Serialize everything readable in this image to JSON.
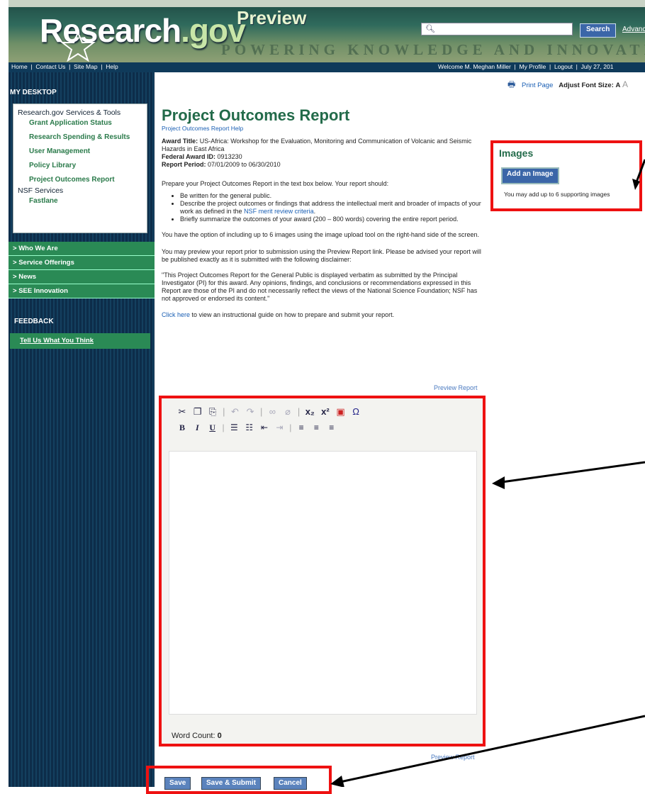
{
  "header": {
    "logo_main": "Research",
    "logo_gov": ".gov",
    "logo_badge": "Preview",
    "tagline": "POWERING KNOWLEDGE AND INNOVATION",
    "search_placeholder": "",
    "search_button": "Search",
    "advanced_link": "Advanced"
  },
  "topnav": {
    "links": [
      "Home",
      "Contact Us",
      "Site Map",
      "Help"
    ],
    "right_items": [
      "Welcome M. Meghan Miller",
      "My Profile",
      "Logout",
      "July 27, 201"
    ]
  },
  "utility": {
    "print_label": "Print Page",
    "font_size_label": "Adjust Font Size:",
    "font_a1": "A",
    "font_a2": "A"
  },
  "sidebar": {
    "desktop_heading": "MY DESKTOP",
    "group1": "Research.gov Services & Tools",
    "group1_items": [
      "Grant Application Status",
      "Research Spending & Results",
      "User Management",
      "Policy Library",
      "Project Outcomes Report"
    ],
    "group2": "NSF Services",
    "group2_items": [
      "Fastlane"
    ],
    "menu": [
      "Who We Are",
      "Service Offerings",
      "News",
      "SEE Innovation"
    ],
    "feedback_heading": "FEEDBACK",
    "feedback_link": "Tell Us What You Think"
  },
  "main": {
    "title": "Project Outcomes Report",
    "help_link": "Project Outcomes Report Help",
    "award_title_label": "Award Title:",
    "award_title": "US-Africa: Workshop for the Evaluation, Monitoring and Communication of Volcanic and Seismic Hazards in East Africa",
    "award_id_label": "Federal Award ID:",
    "award_id": "0913230",
    "period_label": "Report Period:",
    "period": "07/01/2009 to 06/30/2010",
    "intro": "Prepare your Project Outcomes Report in the text box below.  Your report should:",
    "bullet1": "Be written for the general public.",
    "bullet2_pre": "Describe the project outcomes or findings that address the intellectual merit and broader of impacts of your work as defined in the ",
    "bullet2_link": "NSF merit review criteria",
    "bullet2_post": ".",
    "bullet3": "Briefly summarize the outcomes of your award (200 – 800 words) covering the entire report period.",
    "images_option": "You have the option of including up to 6 images using the image upload tool on the right-hand side of the screen.",
    "preview_note": "You may preview your report prior to submission using the Preview Report link.  Please be advised your report will be published exactly as it is submitted with the following disclaimer:",
    "disclaimer": "\"This Project Outcomes Report for the General Public is displayed verbatim as submitted by the Principal Investigator (PI) for this award. Any opinions, findings, and conclusions or recommendations expressed in this Report are those of the PI and do not necessarily reflect the views of the National Science Foundation; NSF has not approved or endorsed its content.\"",
    "click_here": "Click here",
    "guide_text": " to view an instructional guide on how to prepare and submit your report.",
    "preview_report": "Preview Report"
  },
  "editor": {
    "word_count_label": "Word Count:",
    "word_count": "0"
  },
  "images": {
    "title": "Images",
    "add_button": "Add an Image",
    "note": "You may add up to 6 supporting images"
  },
  "actions": {
    "save": "Save",
    "save_submit": "Save & Submit",
    "cancel": "Cancel"
  },
  "colors": {
    "annotation_red": "#ee1111",
    "sidebar_green": "#2a8a55",
    "button_blue": "#3b66a8",
    "title_green": "#236b4a"
  }
}
